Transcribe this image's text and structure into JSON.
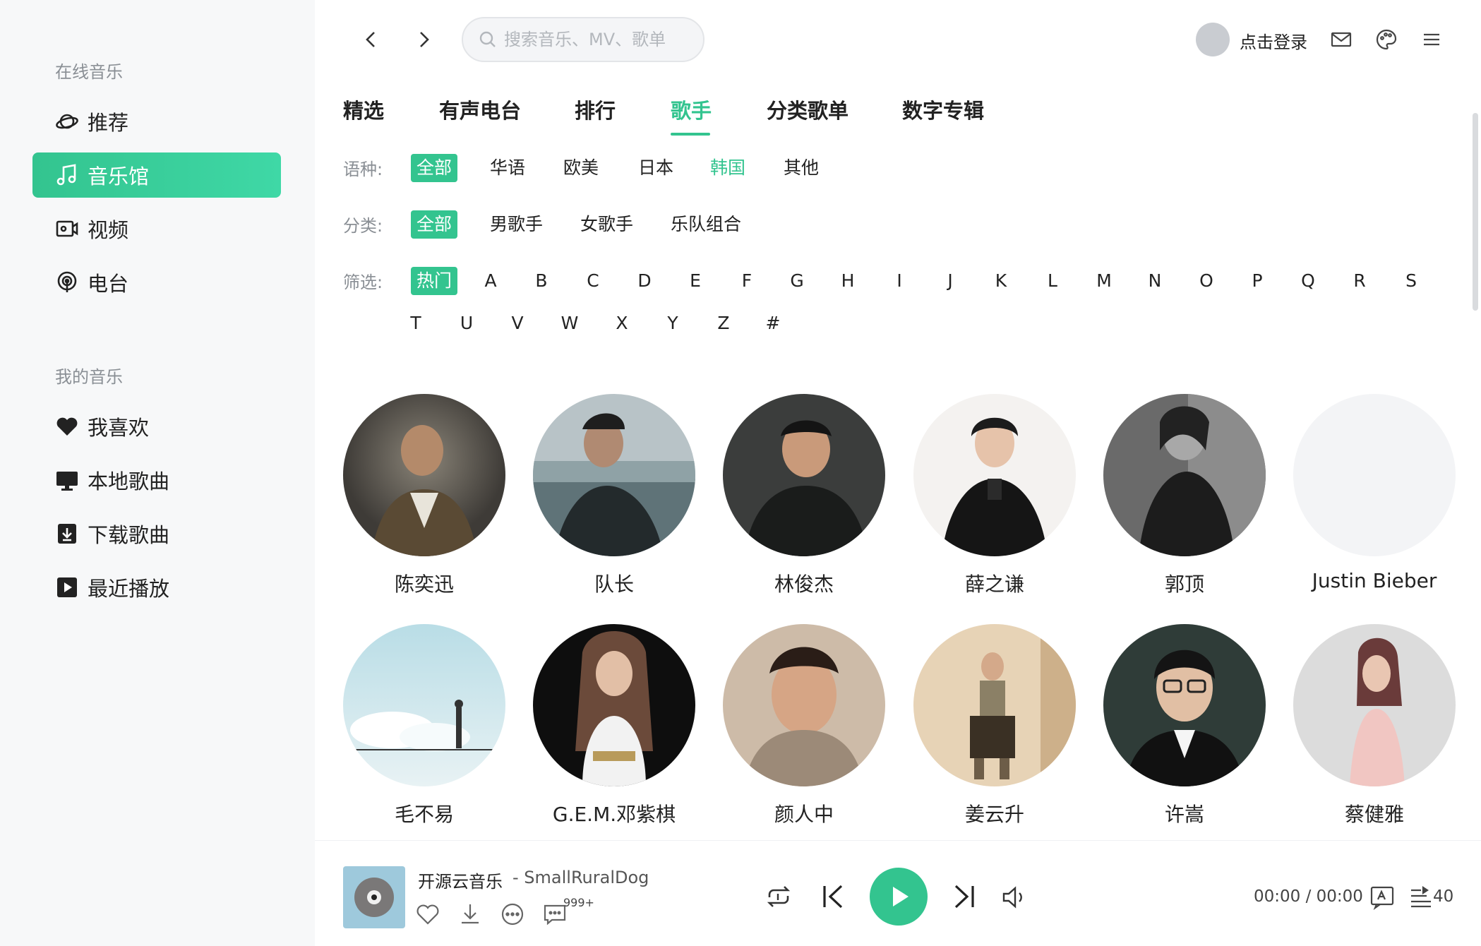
{
  "sidebar": {
    "online_title": "在线音乐",
    "my_title": "我的音乐",
    "online_items": [
      {
        "label": "推荐",
        "icon": "planet-icon"
      },
      {
        "label": "音乐馆",
        "icon": "music-note-icon"
      },
      {
        "label": "视频",
        "icon": "video-icon"
      },
      {
        "label": "电台",
        "icon": "radio-icon"
      }
    ],
    "my_items": [
      {
        "label": "我喜欢",
        "icon": "heart-icon"
      },
      {
        "label": "本地歌曲",
        "icon": "monitor-icon"
      },
      {
        "label": "下载歌曲",
        "icon": "download-icon"
      },
      {
        "label": "最近播放",
        "icon": "play-square-icon"
      }
    ]
  },
  "header": {
    "search_placeholder": "搜索音乐、MV、歌单",
    "login_text": "点击登录"
  },
  "tabs": [
    "精选",
    "有声电台",
    "排行",
    "歌手",
    "分类歌单",
    "数字专辑"
  ],
  "active_tab": "歌手",
  "filters": {
    "language_label": "语种:",
    "language_options": [
      "全部",
      "华语",
      "欧美",
      "日本",
      "韩国",
      "其他"
    ],
    "category_label": "分类:",
    "category_options": [
      "全部",
      "男歌手",
      "女歌手",
      "乐队组合"
    ],
    "filter_label": "筛选:",
    "filter_options": [
      "热门",
      "A",
      "B",
      "C",
      "D",
      "E",
      "F",
      "G",
      "H",
      "I",
      "J",
      "K",
      "L",
      "M",
      "N",
      "O",
      "P",
      "Q",
      "R",
      "S",
      "T",
      "U",
      "V",
      "W",
      "X",
      "Y",
      "Z",
      "#"
    ]
  },
  "artists": [
    {
      "name": "陈奕迅"
    },
    {
      "name": "队长"
    },
    {
      "name": "林俊杰"
    },
    {
      "name": "薛之谦"
    },
    {
      "name": "郭顶"
    },
    {
      "name": "Justin Bieber"
    },
    {
      "name": "毛不易"
    },
    {
      "name": "G.E.M.邓紫棋"
    },
    {
      "name": "颜人中"
    },
    {
      "name": "姜云升"
    },
    {
      "name": "许嵩"
    },
    {
      "name": "蔡健雅"
    }
  ],
  "player": {
    "song_title": "开源云音乐",
    "song_artist": "- SmallRuralDog",
    "comment_count": "999+",
    "time": "00:00 / 00:00",
    "queue_count": "40"
  },
  "colors": {
    "accent": "#33c48f",
    "sidebar_bg": "#f7f8f9",
    "text": "#222222",
    "muted": "#8a8f95"
  }
}
